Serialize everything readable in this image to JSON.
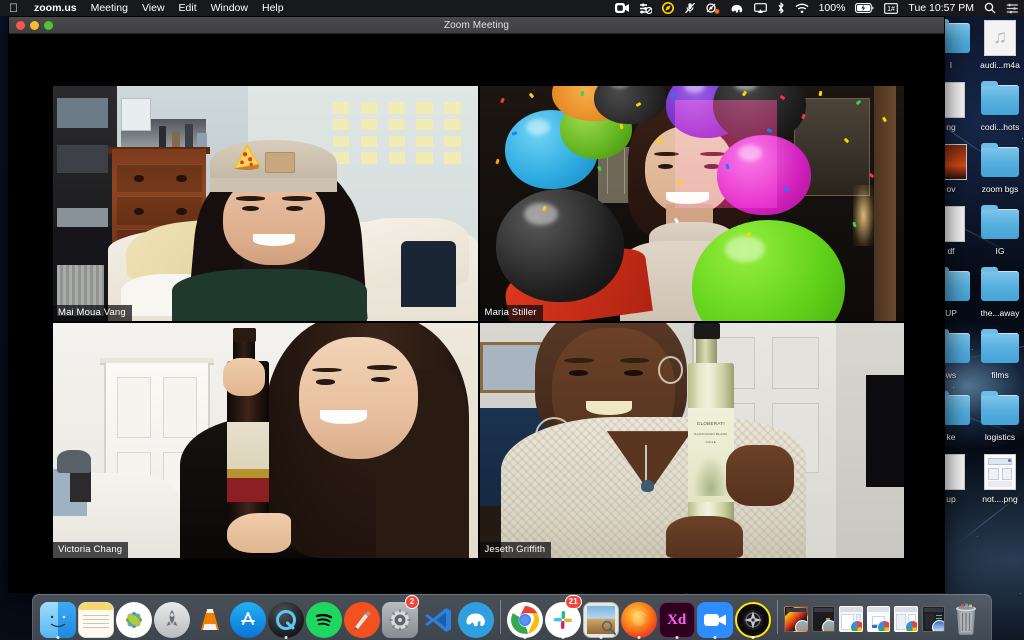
{
  "menubar": {
    "apple_icon": "apple-logo",
    "app_name": "zoom.us",
    "items": [
      "Meeting",
      "View",
      "Edit",
      "Window",
      "Help"
    ],
    "status_icons": [
      "video-camera-icon",
      "network-stats-icon",
      "yellow-circle-icon",
      "microphone-muted-icon",
      "screen-record-icon",
      "evernote-elephant-icon",
      "airplay-icon",
      "bluetooth-icon",
      "wifi-icon"
    ],
    "battery_percent": "100%",
    "battery_icon": "battery-charging-icon",
    "input_source_icon": "keyboard-input-icon",
    "clock": "Tue 10:57 PM",
    "search_icon": "search-icon",
    "control_center_icon": "control-center-icon"
  },
  "window": {
    "title": "Zoom Meeting",
    "traffic_lights": [
      "close-button",
      "minimize-button",
      "zoom-button"
    ]
  },
  "meeting": {
    "participants": [
      {
        "name": "Mai Moua Vang",
        "active_speaker": false,
        "position": "top-left"
      },
      {
        "name": "Maria Stiller",
        "active_speaker": false,
        "position": "top-right"
      },
      {
        "name": "Victoria Chang",
        "active_speaker": true,
        "position": "bottom-left"
      },
      {
        "name": "Jeseth Griffith",
        "active_speaker": false,
        "position": "bottom-right"
      }
    ],
    "active_speaker_color": "#d6e67a",
    "wine_label_brand": "GLOBERATI",
    "wine_label_varietal": "SAUVIGNON BLANC",
    "wine_label_origin": "CHILE"
  },
  "desktop": {
    "icons": [
      {
        "label": "audi...m4a",
        "type": "audio-file"
      },
      {
        "label": "codi...hots",
        "type": "folder"
      },
      {
        "label": "zoom bgs",
        "type": "folder"
      },
      {
        "label": "IG",
        "type": "folder"
      },
      {
        "label": "the...away",
        "type": "folder"
      },
      {
        "label": "films",
        "type": "folder"
      },
      {
        "label": "logistics",
        "type": "folder"
      },
      {
        "label": "not....png",
        "type": "image-file"
      }
    ],
    "partial_icons": [
      {
        "label": "l",
        "type": "folder"
      },
      {
        "label": "ng",
        "type": "document"
      },
      {
        "label": "ov",
        "type": "image-file"
      },
      {
        "label": "df",
        "type": "document"
      },
      {
        "label": "UP",
        "type": "folder"
      },
      {
        "label": "ws",
        "type": "folder"
      },
      {
        "label": "ke",
        "type": "folder"
      },
      {
        "label": "up",
        "type": "document"
      }
    ]
  },
  "dock": {
    "apps": [
      {
        "name": "Finder",
        "icon": "finder-icon",
        "running": true,
        "badge": null
      },
      {
        "name": "Notes",
        "icon": "notes-icon",
        "running": false,
        "badge": null
      },
      {
        "name": "Photos",
        "icon": "photos-icon",
        "running": false,
        "badge": null
      },
      {
        "name": "Launchpad",
        "icon": "launchpad-icon",
        "running": false,
        "badge": null
      },
      {
        "name": "VLC",
        "icon": "vlc-cone-icon",
        "running": false,
        "badge": null
      },
      {
        "name": "App Store",
        "icon": "app-store-icon",
        "running": false,
        "badge": null
      },
      {
        "name": "QuickTime Player",
        "icon": "quicktime-icon",
        "running": true,
        "badge": null
      },
      {
        "name": "Spotify",
        "icon": "spotify-icon",
        "running": false,
        "badge": null
      },
      {
        "name": "Preview",
        "icon": "preview-icon",
        "running": false,
        "badge": null
      },
      {
        "name": "System Preferences",
        "icon": "system-prefs-icon",
        "running": false,
        "badge": "2"
      },
      {
        "name": "Visual Studio Code",
        "icon": "vscode-icon",
        "running": false,
        "badge": null
      },
      {
        "name": "Evernote",
        "icon": "evernote-icon",
        "running": false,
        "badge": null
      },
      {
        "name": "Google Chrome",
        "icon": "chrome-icon",
        "running": true,
        "badge": null
      },
      {
        "name": "Slack",
        "icon": "slack-icon",
        "running": true,
        "badge": "21"
      },
      {
        "name": "Image Capture",
        "icon": "image-capture-icon",
        "running": true,
        "badge": null
      },
      {
        "name": "Firefox",
        "icon": "firefox-icon",
        "running": true,
        "badge": null
      },
      {
        "name": "Adobe XD",
        "icon": "adobe-xd-icon",
        "running": true,
        "badge": null
      },
      {
        "name": "Zoom",
        "icon": "zoom-camera-icon",
        "running": true,
        "badge": null
      },
      {
        "name": "Dark Compass App",
        "icon": "compass-icon",
        "running": true,
        "badge": null
      }
    ],
    "adobe_xd_label": "Xd",
    "minimized_windows": [
      "heatmap-window",
      "dark-editor-window",
      "chrome-window-1",
      "chrome-window-2",
      "chrome-window-3",
      "code-editor-window"
    ],
    "trash": "Trash"
  }
}
